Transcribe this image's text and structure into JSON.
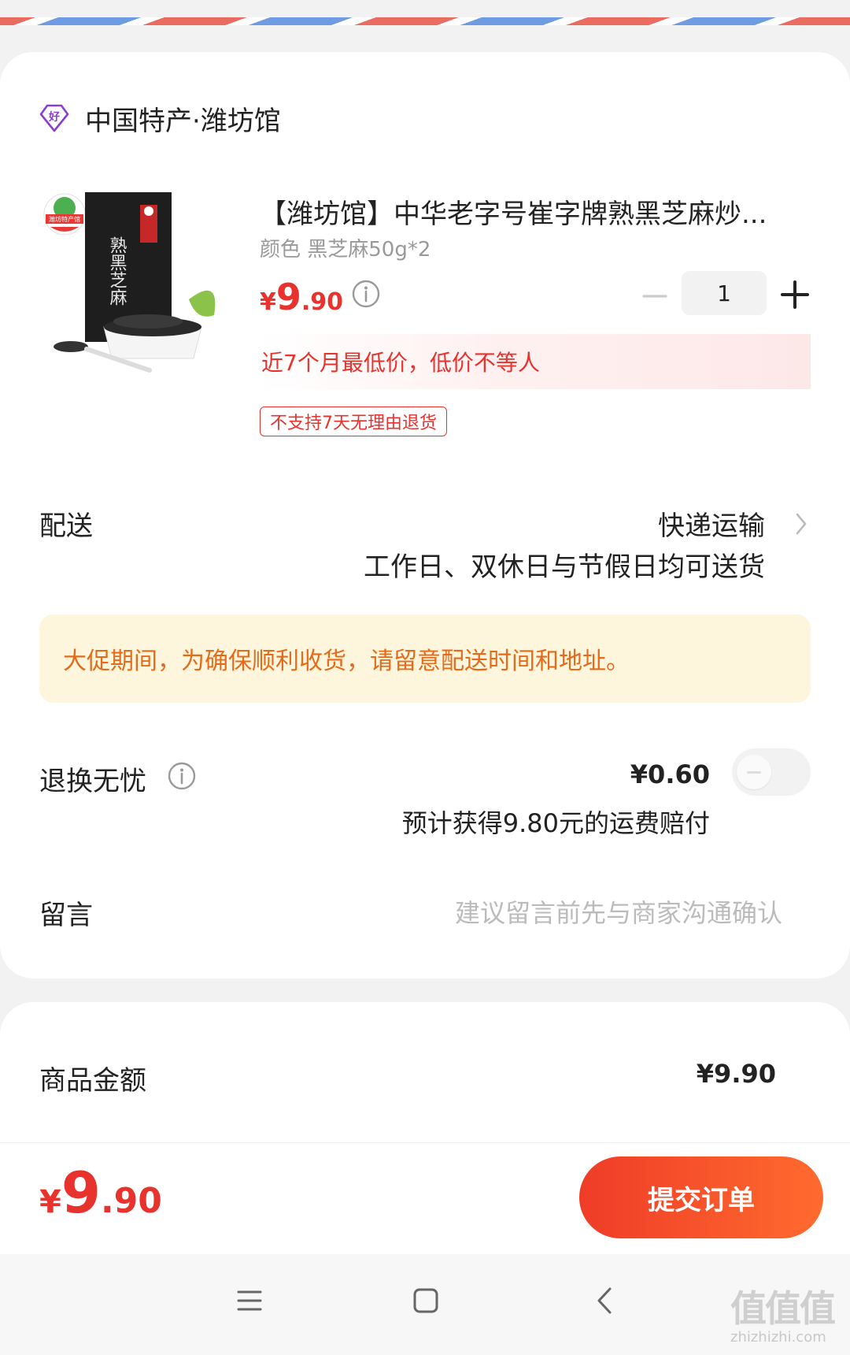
{
  "shop": {
    "name": "中国特产·潍坊馆",
    "icon": "diamond-hao-icon"
  },
  "product": {
    "title": "【潍坊馆】中华老字号崔字牌熟黑芝麻炒...",
    "spec": "颜色 黑芝麻50g*2",
    "price": {
      "currency": "¥",
      "integer": "9",
      "decimal": ".90"
    },
    "quantity": "1",
    "lowprice_banner": "近7个月最低价，低价不等人",
    "tag": "不支持7天无理由退货",
    "image_label": "熟黑芝麻",
    "image_brand": "潍坊特产馆"
  },
  "delivery": {
    "label": "配送",
    "method": "快递运输",
    "note": "工作日、双休日与节假日均可送货"
  },
  "promo_notice": "大促期间，为确保顺利收货，请留意配送时间和地址。",
  "return_service": {
    "label": "退换无忧",
    "price": "¥0.60",
    "note": "预计获得9.80元的运费赔付",
    "enabled": false
  },
  "message": {
    "label": "留言",
    "placeholder": "建议留言前先与商家沟通确认"
  },
  "summary": {
    "label": "商品金额",
    "value": "¥9.90"
  },
  "footer": {
    "total": {
      "currency": "¥",
      "integer": "9",
      "decimal": ".90"
    },
    "submit_label": "提交订单"
  },
  "watermark": {
    "logo": "值值值",
    "url": "zhizhizhi.com"
  },
  "colors": {
    "accent_red": "#e8322d",
    "promo_orange": "#e56a1a",
    "promo_bg": "#fdf6dc",
    "button_gradient_start": "#ef3c28",
    "button_gradient_end": "#ff6b2e"
  }
}
